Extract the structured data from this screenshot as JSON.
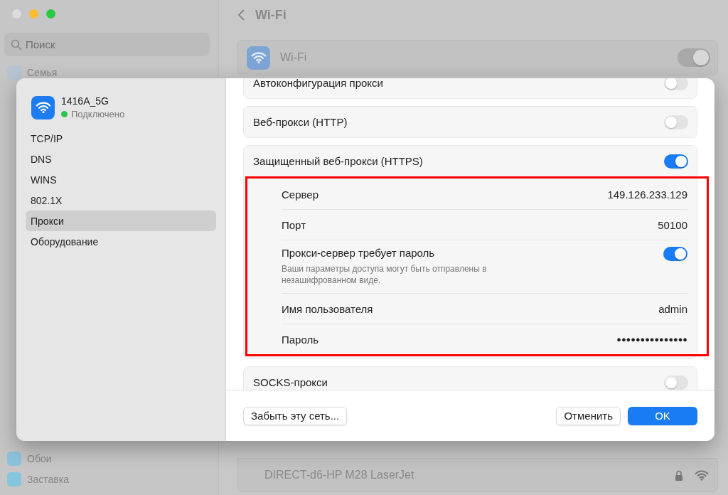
{
  "background": {
    "search": {
      "placeholder": "Поиск"
    },
    "sidebar_top": [
      {
        "label": "Семья"
      }
    ],
    "sidebar_bottom": [
      {
        "label": "Обои"
      },
      {
        "label": "Заставка"
      }
    ],
    "header": {
      "title": "Wi-Fi"
    },
    "wifi_card": {
      "label": "Wi-Fi",
      "on": true
    },
    "networks": [
      {
        "name": "DIRECT-d6-HP M28 LaserJet",
        "locked": true
      }
    ]
  },
  "dialog": {
    "network": {
      "name": "1416A_5G",
      "status": "Подключено"
    },
    "nav": [
      {
        "label": "TCP/IP",
        "selected": false
      },
      {
        "label": "DNS",
        "selected": false
      },
      {
        "label": "WINS",
        "selected": false
      },
      {
        "label": "802.1X",
        "selected": false
      },
      {
        "label": "Прокси",
        "selected": true
      },
      {
        "label": "Оборудование",
        "selected": false
      }
    ],
    "proxies": [
      {
        "label": "Автоконфигурация прокси",
        "on": false
      },
      {
        "label": "Веб-прокси (HTTP)",
        "on": false
      },
      {
        "label": "Защищенный веб-прокси (HTTPS)",
        "on": true,
        "highlighted": true,
        "details": [
          {
            "kind": "value",
            "label": "Сервер",
            "value": "149.126.233.129"
          },
          {
            "kind": "value",
            "label": "Порт",
            "value": "50100"
          },
          {
            "kind": "toggle",
            "label": "Прокси-сервер требует пароль",
            "note": "Ваши параметры доступа могут быть отправлены в незашифрованном виде.",
            "on": true
          },
          {
            "kind": "value",
            "label": "Имя пользователя",
            "value": "admin"
          },
          {
            "kind": "password",
            "label": "Пароль",
            "value": "●●●●●●●●●●●●●●●"
          }
        ]
      },
      {
        "label": "SOCKS-прокси",
        "on": false
      }
    ],
    "buttons": [
      {
        "label": "Забыть эту сеть...",
        "kind": "plain"
      },
      {
        "label": "Отменить",
        "kind": "plain"
      },
      {
        "label": "OK",
        "kind": "primary"
      }
    ]
  }
}
